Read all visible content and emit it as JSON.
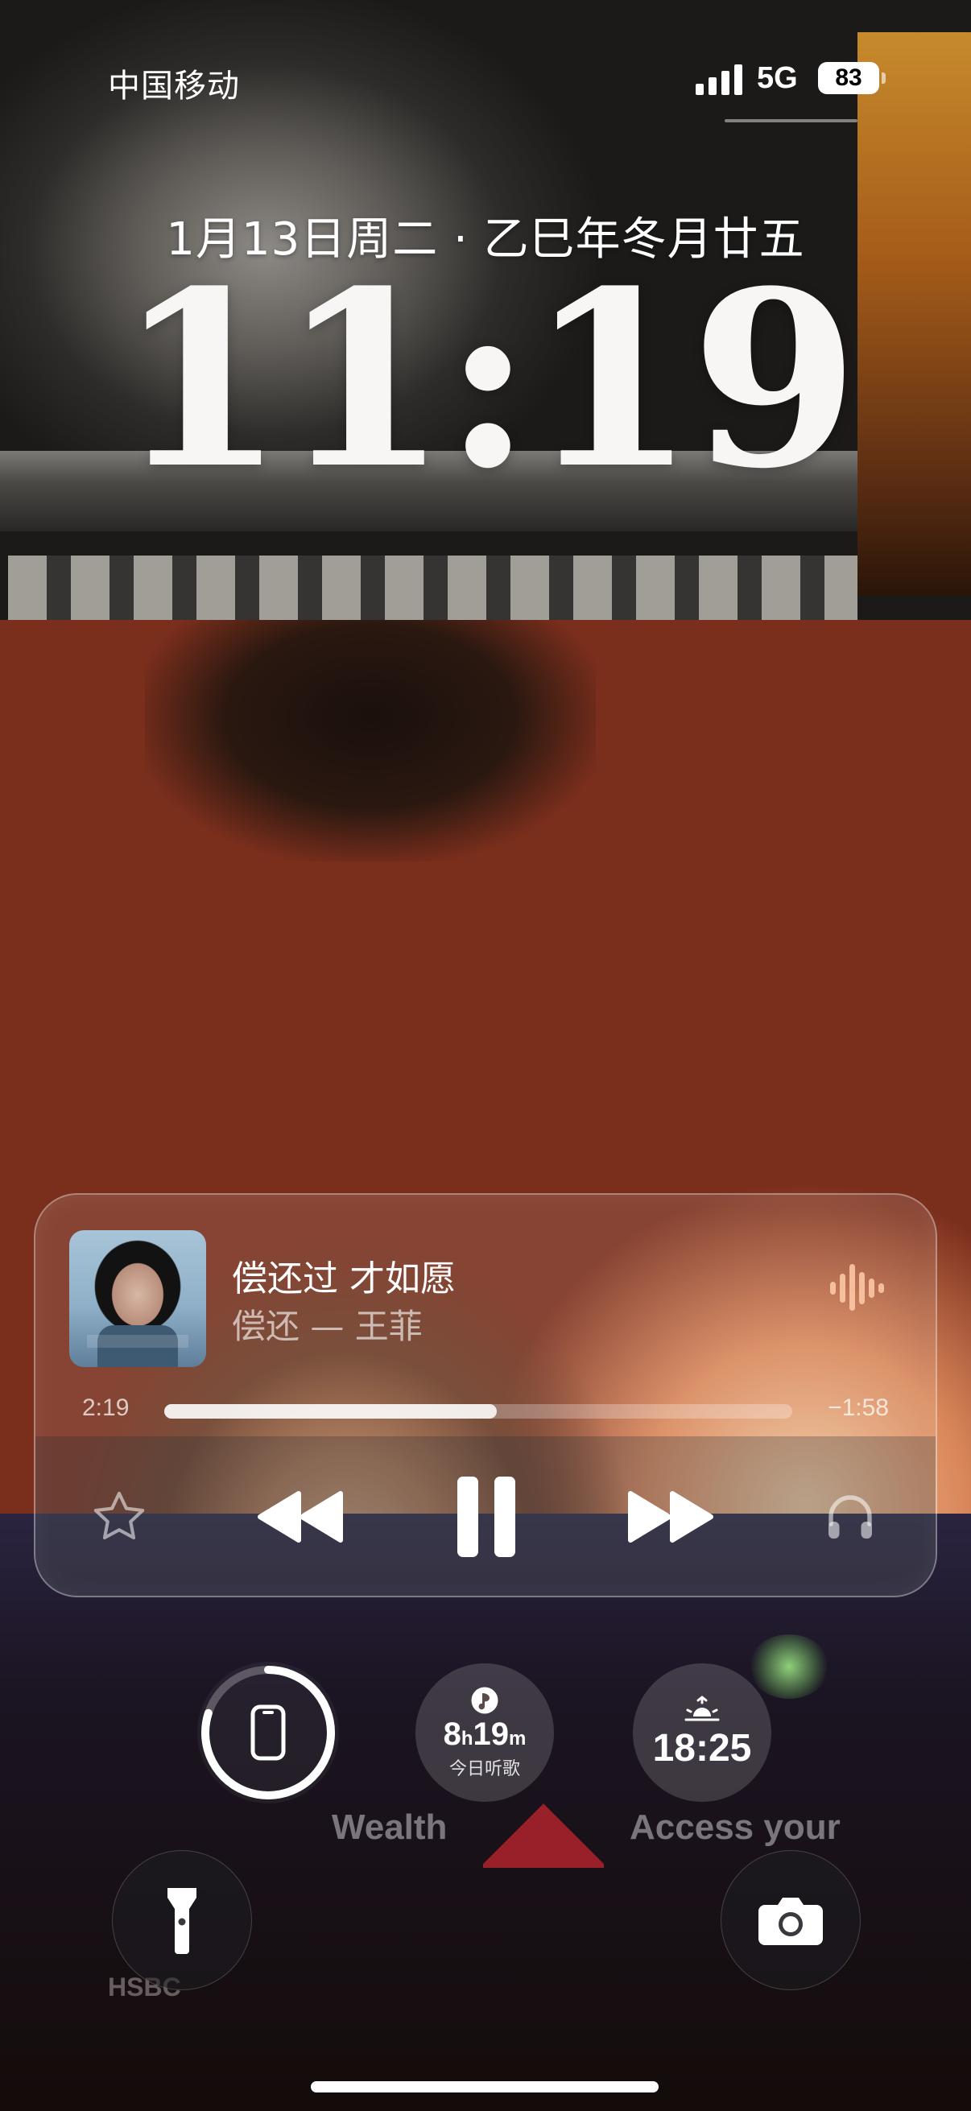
{
  "status_bar": {
    "carrier": "中国移动",
    "network": "5G",
    "battery_level": "83"
  },
  "lock_screen": {
    "date": "1月13日周二 · 乙巳年冬月廿五",
    "time": "11:19"
  },
  "now_playing": {
    "title": "偿还过 才如愿",
    "subtitle": "偿还 — 王菲",
    "elapsed": "2:19",
    "remaining": "−1:58",
    "progress_fraction": 0.53,
    "controls": {
      "favorite_icon": "star-icon",
      "rewind_icon": "rewind-icon",
      "pause_icon": "pause-icon",
      "forward_icon": "fast-forward-icon",
      "output_icon": "headphones-icon"
    }
  },
  "widgets": {
    "device_battery": {
      "icon": "phone-icon",
      "level_fraction": 0.8
    },
    "listening": {
      "hours": "8",
      "hours_unit": "h",
      "minutes": "19",
      "minutes_unit": "m",
      "label": "今日听歌"
    },
    "sunset": {
      "icon": "sunset-icon",
      "time": "18:25"
    }
  },
  "quick_actions": {
    "flashlight_icon": "flashlight-icon",
    "camera_icon": "camera-icon"
  },
  "wallpaper": {
    "ad_words": [
      "Wealth",
      "Access your"
    ],
    "brand": "HSBC"
  },
  "colors": {
    "accent_warm": "#ffcfaa",
    "hsbc_red": "#c4262e"
  }
}
